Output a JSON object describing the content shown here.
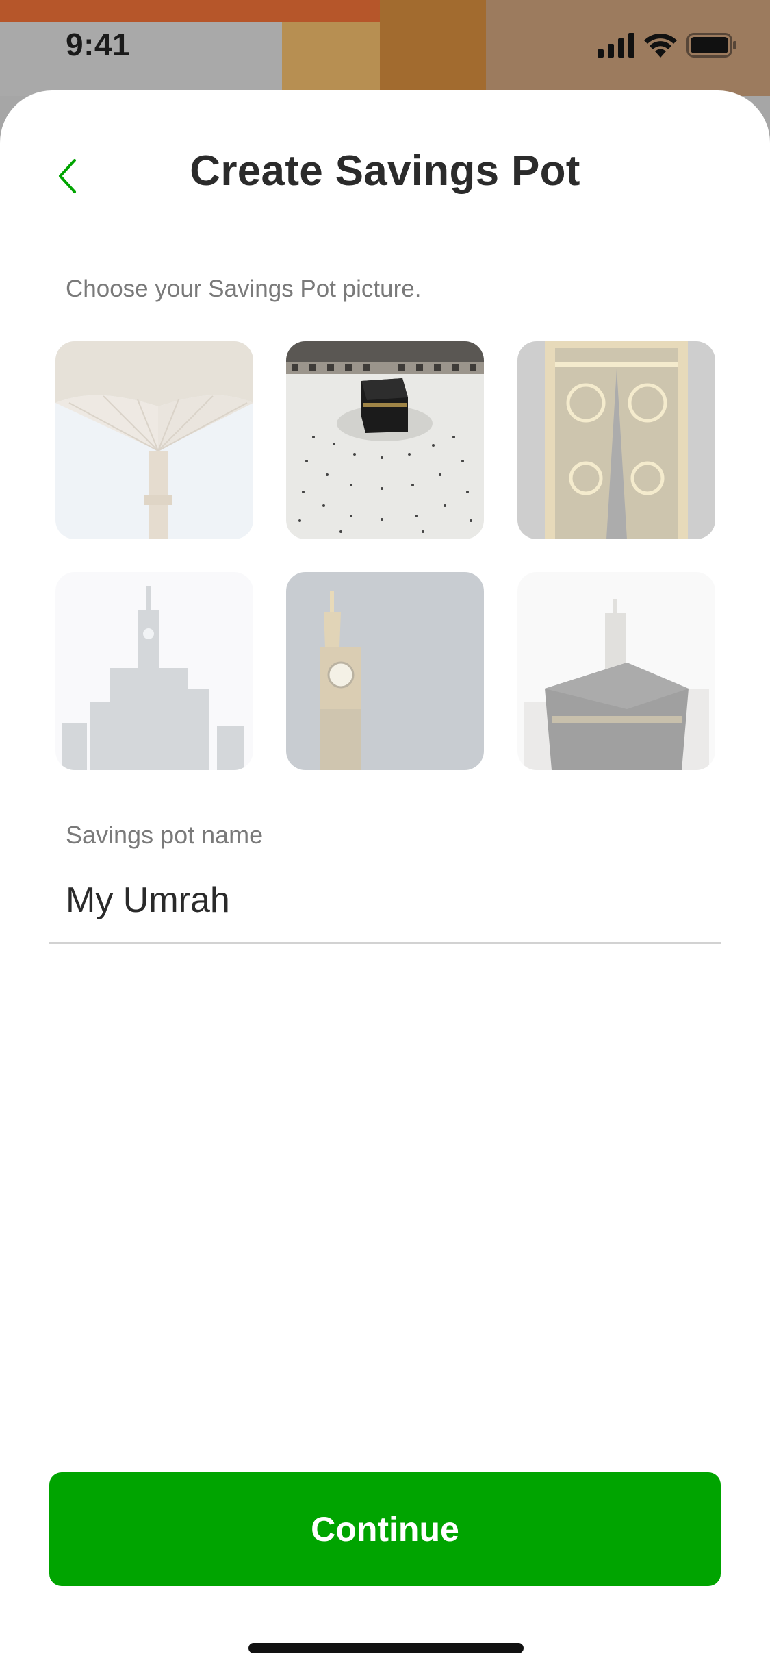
{
  "status_bar": {
    "time": "9:41"
  },
  "header": {
    "title": "Create Savings Pot"
  },
  "picture_picker": {
    "instruction": "Choose your Savings Pot picture.",
    "images": [
      {
        "name": "umbrella-canopy-image",
        "selected": false
      },
      {
        "name": "kaaba-aerial-image",
        "selected": true
      },
      {
        "name": "kaaba-door-image",
        "selected": false
      },
      {
        "name": "clock-tower-skyline-image",
        "selected": false
      },
      {
        "name": "clock-tower-image",
        "selected": false
      },
      {
        "name": "kaaba-clock-tower-image",
        "selected": false
      }
    ]
  },
  "form": {
    "name_label": "Savings pot name",
    "name_value": "My Umrah"
  },
  "footer": {
    "continue_label": "Continue"
  },
  "colors": {
    "accent": "#00A400",
    "title": "#2B2B2B",
    "muted": "#7A7A7A"
  }
}
